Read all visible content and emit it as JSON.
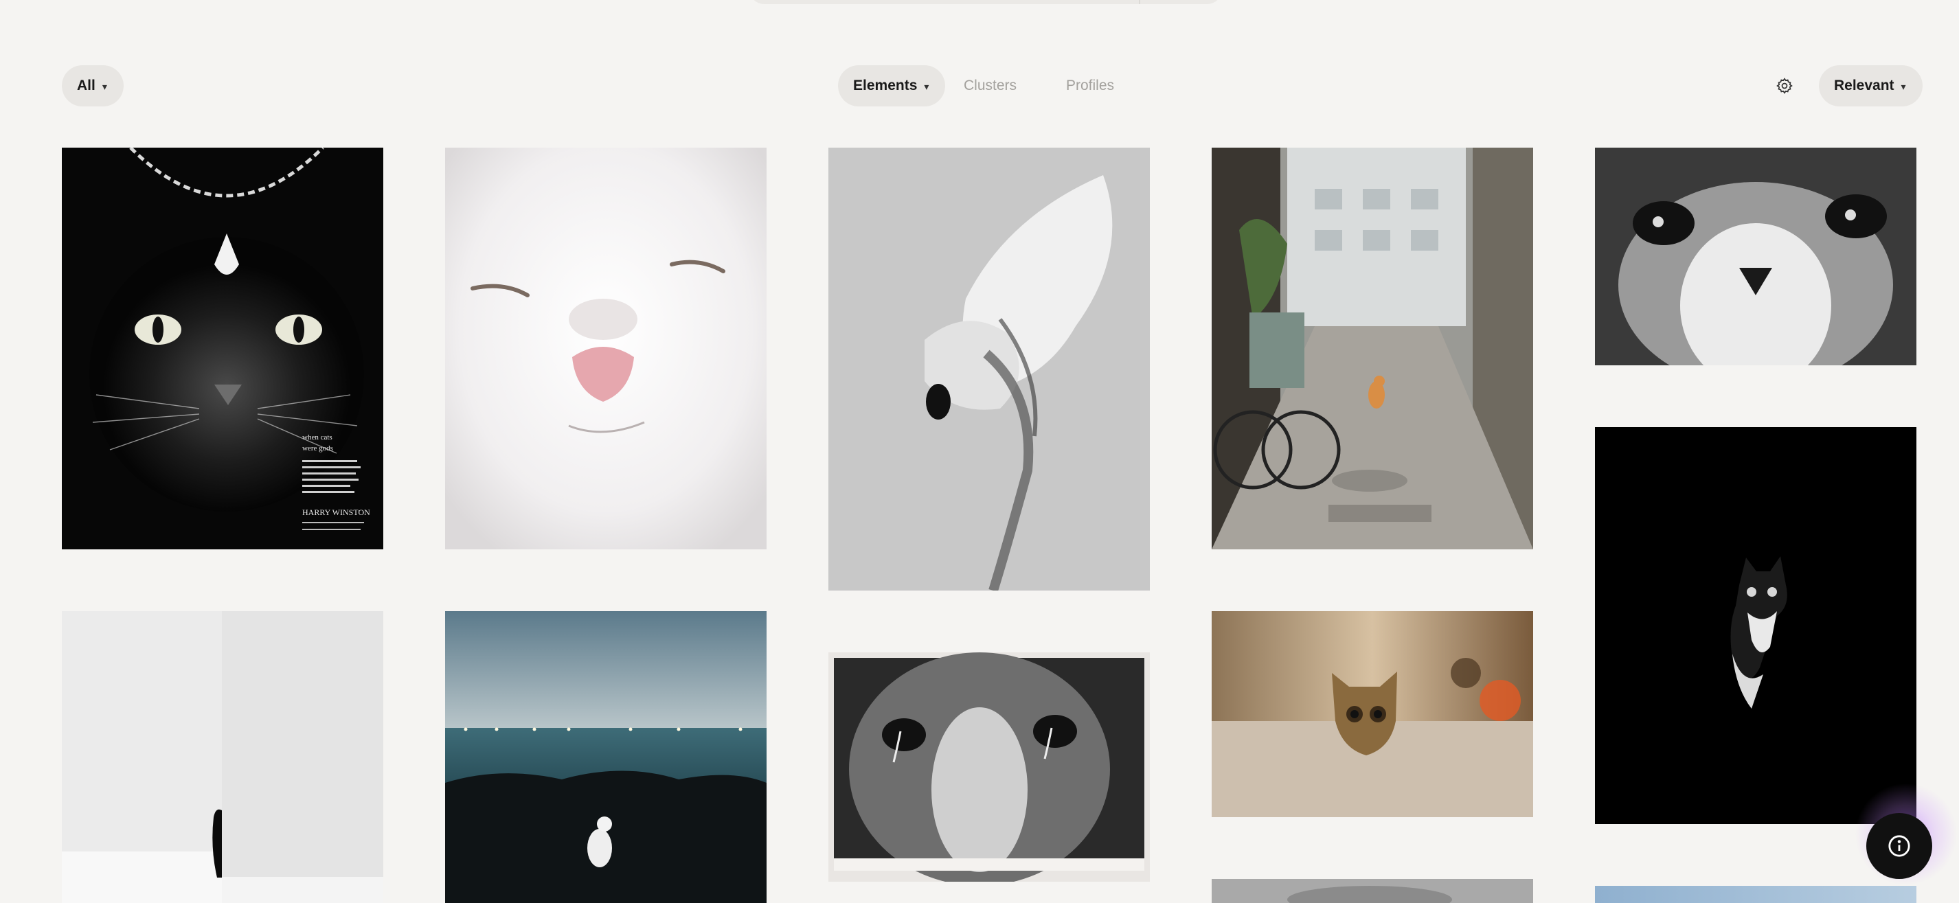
{
  "filters": {
    "all_label": "All",
    "tabs": [
      {
        "label": "Elements",
        "active": true
      },
      {
        "label": "Clusters",
        "active": false
      },
      {
        "label": "Profiles",
        "active": false
      }
    ],
    "sort_label": "Relevant"
  },
  "icons": {
    "chevron": "chevron-down-icon",
    "settings": "gear-icon",
    "info": "info-icon"
  },
  "grid": {
    "items": [
      {
        "id": "cat-black-necklace-ad",
        "ad_text": {
          "headline_1": "when cats",
          "headline_2": "were gods",
          "brand": "HARRY WINSTON"
        }
      },
      {
        "id": "cat-white-closeup"
      },
      {
        "id": "abstract-gray-figure"
      },
      {
        "id": "alley-orange-cat"
      },
      {
        "id": "cat-tabby-eyes-bw"
      },
      {
        "id": "cat-minimal-wall"
      },
      {
        "id": "cat-white-on-rocks-sea"
      },
      {
        "id": "cat-photo-print-bw"
      },
      {
        "id": "cat-peeking-table"
      },
      {
        "id": "cat-black-white-dark"
      },
      {
        "id": "partial-gray"
      },
      {
        "id": "partial-sky"
      }
    ]
  },
  "colors": {
    "background": "#f5f4f2",
    "pill": "#e8e6e3",
    "muted_text": "#a3a19d",
    "info_button": "#111111",
    "glow": "#b46eff"
  }
}
